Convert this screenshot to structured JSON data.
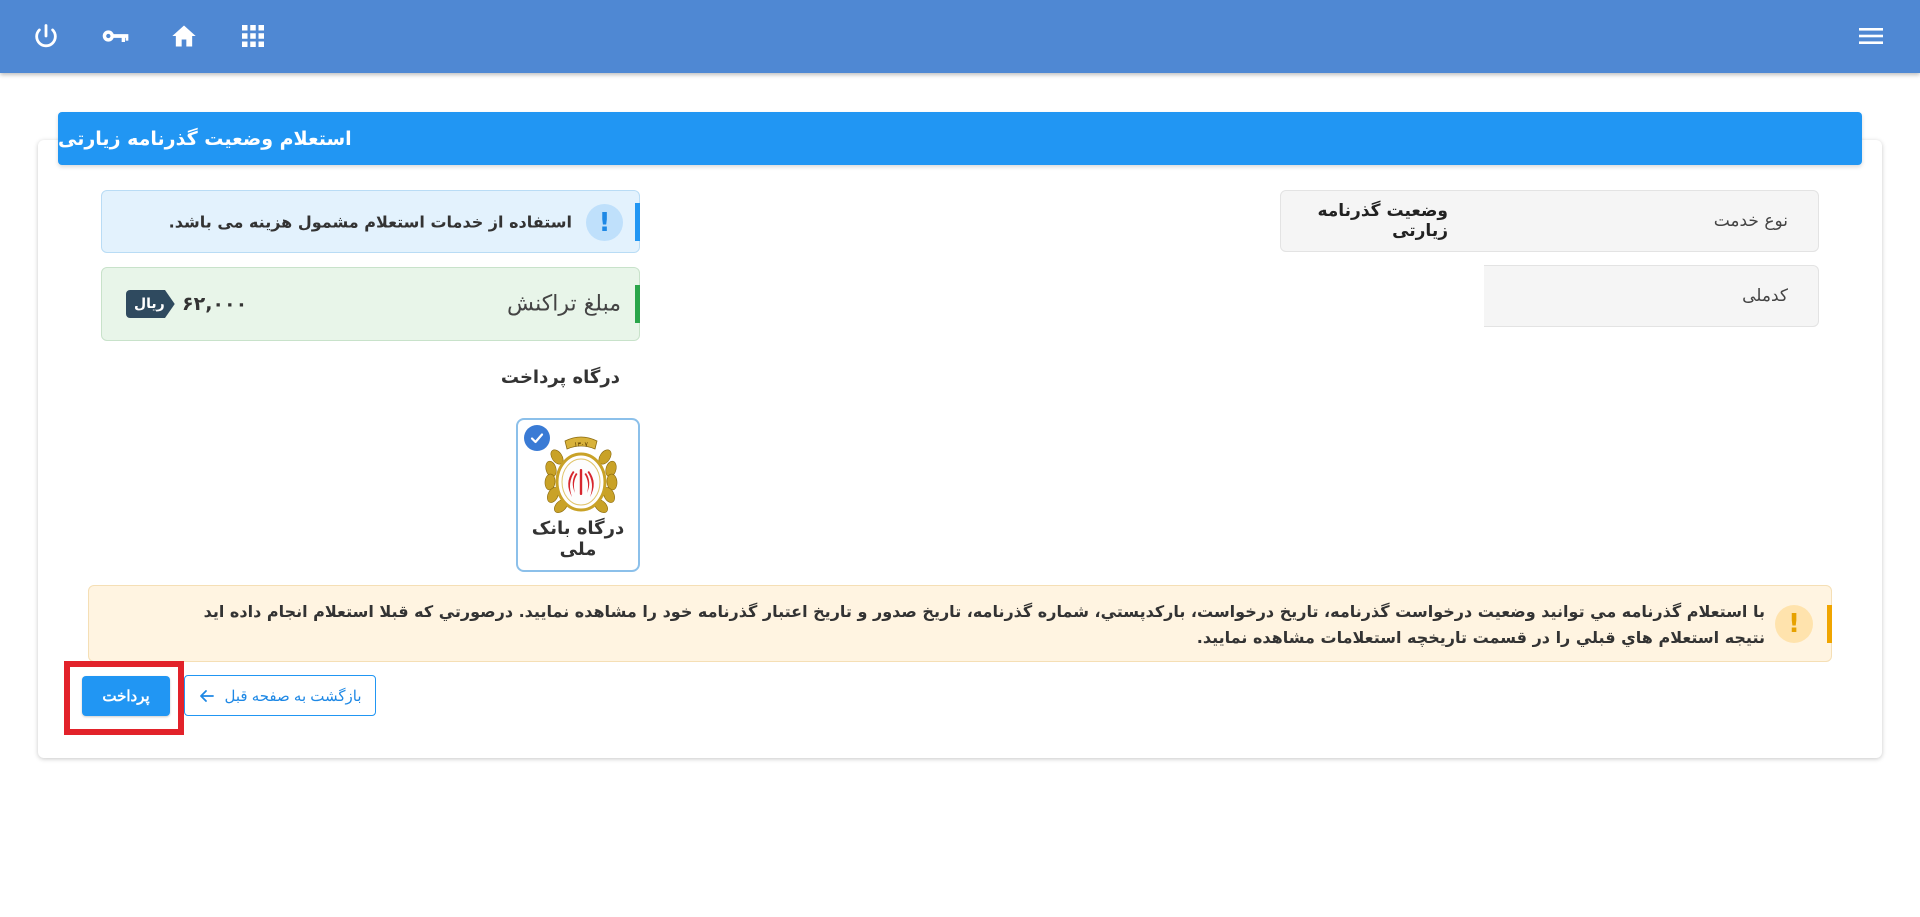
{
  "topbar": {
    "icons": [
      "power-icon",
      "key-icon",
      "home-icon",
      "apps-grid-icon",
      "menu-icon"
    ]
  },
  "header": {
    "title": "استعلام وضعیت گذرنامه زیارتی"
  },
  "form": {
    "service_type_label": "نوع خدمت",
    "service_type_value": "وضعیت گذرنامه زیارتی",
    "national_code_label": "کدملی",
    "national_code_value": ""
  },
  "info": {
    "text": "استفاده از خدمات استعلام مشمول هزینه می باشد."
  },
  "transaction": {
    "title": "مبلغ تراکنش",
    "amount": "۶۲,۰۰۰",
    "currency": "ریال"
  },
  "gateway": {
    "section_title": "درگاه پرداخت",
    "selected_name": "درگاه بانک ملی",
    "logo_year": "۱۳۰۷"
  },
  "warning": {
    "text": "با استعلام گذرنامه مي توانيد وضعیت درخواست گذرنامه، تاريخ درخواست، بارکدپستي، شماره گذرنامه، تاریخ صدور و تاريخ اعتبار گذرنامه خود را مشاهده نماييد. درصورتي که قبلا استعلام انجام داده ايد نتيجه استعلام هاي قبلي را در قسمت تاريخچه استعلامات مشاهده نمایید."
  },
  "actions": {
    "pay_label": "پرداخت",
    "back_label": "بازگشت به صفحه قبل"
  },
  "colors": {
    "topbar": "#4f88d3",
    "primary": "#2196f3",
    "success_bar": "#2aa54a",
    "warning_bar": "#f0a500",
    "highlight": "#e2222a"
  }
}
